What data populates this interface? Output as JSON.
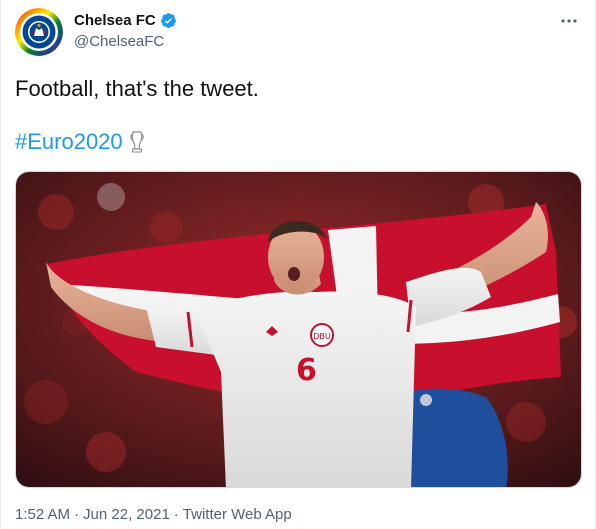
{
  "author": {
    "display_name": "Chelsea FC",
    "handle": "@ChelseaFC",
    "verified": true
  },
  "tweet": {
    "text": "Football, that's the tweet.",
    "hashtag": "#Euro2020"
  },
  "meta": {
    "time": "1:52 AM",
    "separator1": "·",
    "date": "Jun 22, 2021",
    "separator2": "·",
    "source": "Twitter Web App"
  },
  "jersey_number": "6",
  "icons": {
    "verified": "verified-badge-icon",
    "more": "more-dots-icon",
    "trophy": "trophy-emoji-icon"
  },
  "colors": {
    "link": "#1d9bf0",
    "secondary_text": "#536471",
    "primary_text": "#0f1419",
    "flag_red": "#c8102e"
  }
}
